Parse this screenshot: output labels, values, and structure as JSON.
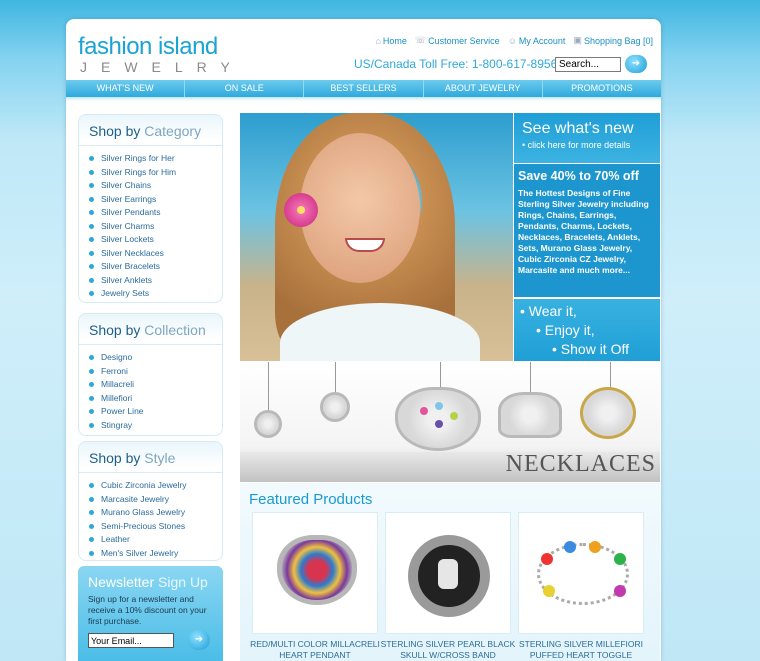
{
  "header": {
    "logo_line1": "fashion island",
    "logo_line2": "JEWELRY",
    "links": [
      {
        "label": "Home",
        "icon": "home-icon"
      },
      {
        "label": "Customer Service",
        "icon": "headset-icon"
      },
      {
        "label": "My Account",
        "icon": "user-icon"
      },
      {
        "label": "Shopping Bag [0]",
        "icon": "bag-icon"
      }
    ],
    "tollfree": "US/Canada Toll Free: 1-800-617-8956",
    "search_value": "Search..."
  },
  "nav": [
    "WHAT'S NEW",
    "ON SALE",
    "BEST SELLERS",
    "ABOUT JEWELRY",
    "PROMOTIONS"
  ],
  "sidebar": {
    "category": {
      "title_a": "Shop by",
      "title_b": "Category",
      "items": [
        "Silver Rings for Her",
        "Silver Rings for Him",
        "Silver Chains",
        "Silver Earrings",
        "Silver Pendants",
        "Silver Charms",
        "Silver Lockets",
        "Silver Necklaces",
        "Silver Bracelets",
        "Silver Anklets",
        "Jewelry Sets"
      ]
    },
    "collection": {
      "title_a": "Shop by",
      "title_b": "Collection",
      "items": [
        "Designo",
        "Ferroni",
        "Millacreli",
        "Millefiori",
        "Power Line",
        "Stingray"
      ]
    },
    "style": {
      "title_a": "Shop by",
      "title_b": "Style",
      "items": [
        "Cubic Zirconia Jewelry",
        "Marcasite Jewelry",
        "Murano Glass Jewelry",
        "Semi-Precious Stones",
        "Leather",
        "Men's Silver Jewelry"
      ]
    }
  },
  "newsletter": {
    "title_a": "Newsletter",
    "title_b": "Sign Up",
    "text": "Sign up for a newsletter and receive a 10% discount on your first purchase.",
    "email_value": "Your Email..."
  },
  "promo": {
    "see_new": "See what's new",
    "click_here": "• click here for more details",
    "save": "Save 40% to 70% off",
    "save_text": "The Hottest Designs of Fine Sterling Silver Jewelry including Rings, Chains, Earrings, Pendants, Charms, Lockets, Necklaces, Bracelets, Anklets, Sets, Murano Glass Jewelry, Cubic Zirconia CZ Jewelry, Marcasite and much more...",
    "wear": "• Wear it,",
    "enjoy": "• Enjoy it,",
    "show": "• Show it Off"
  },
  "banner": {
    "title": "NECKLACES"
  },
  "featured": {
    "title": "Featured Products",
    "products": [
      {
        "name": "RED/MULTI COLOR MILLACRELI HEART PENDANT"
      },
      {
        "name": "STERLING SILVER PEARL BLACK SKULL W/CROSS BAND"
      },
      {
        "name": "STERLING SILVER MILLEFIORI PUFFED HEART TOGGLE"
      }
    ]
  }
}
